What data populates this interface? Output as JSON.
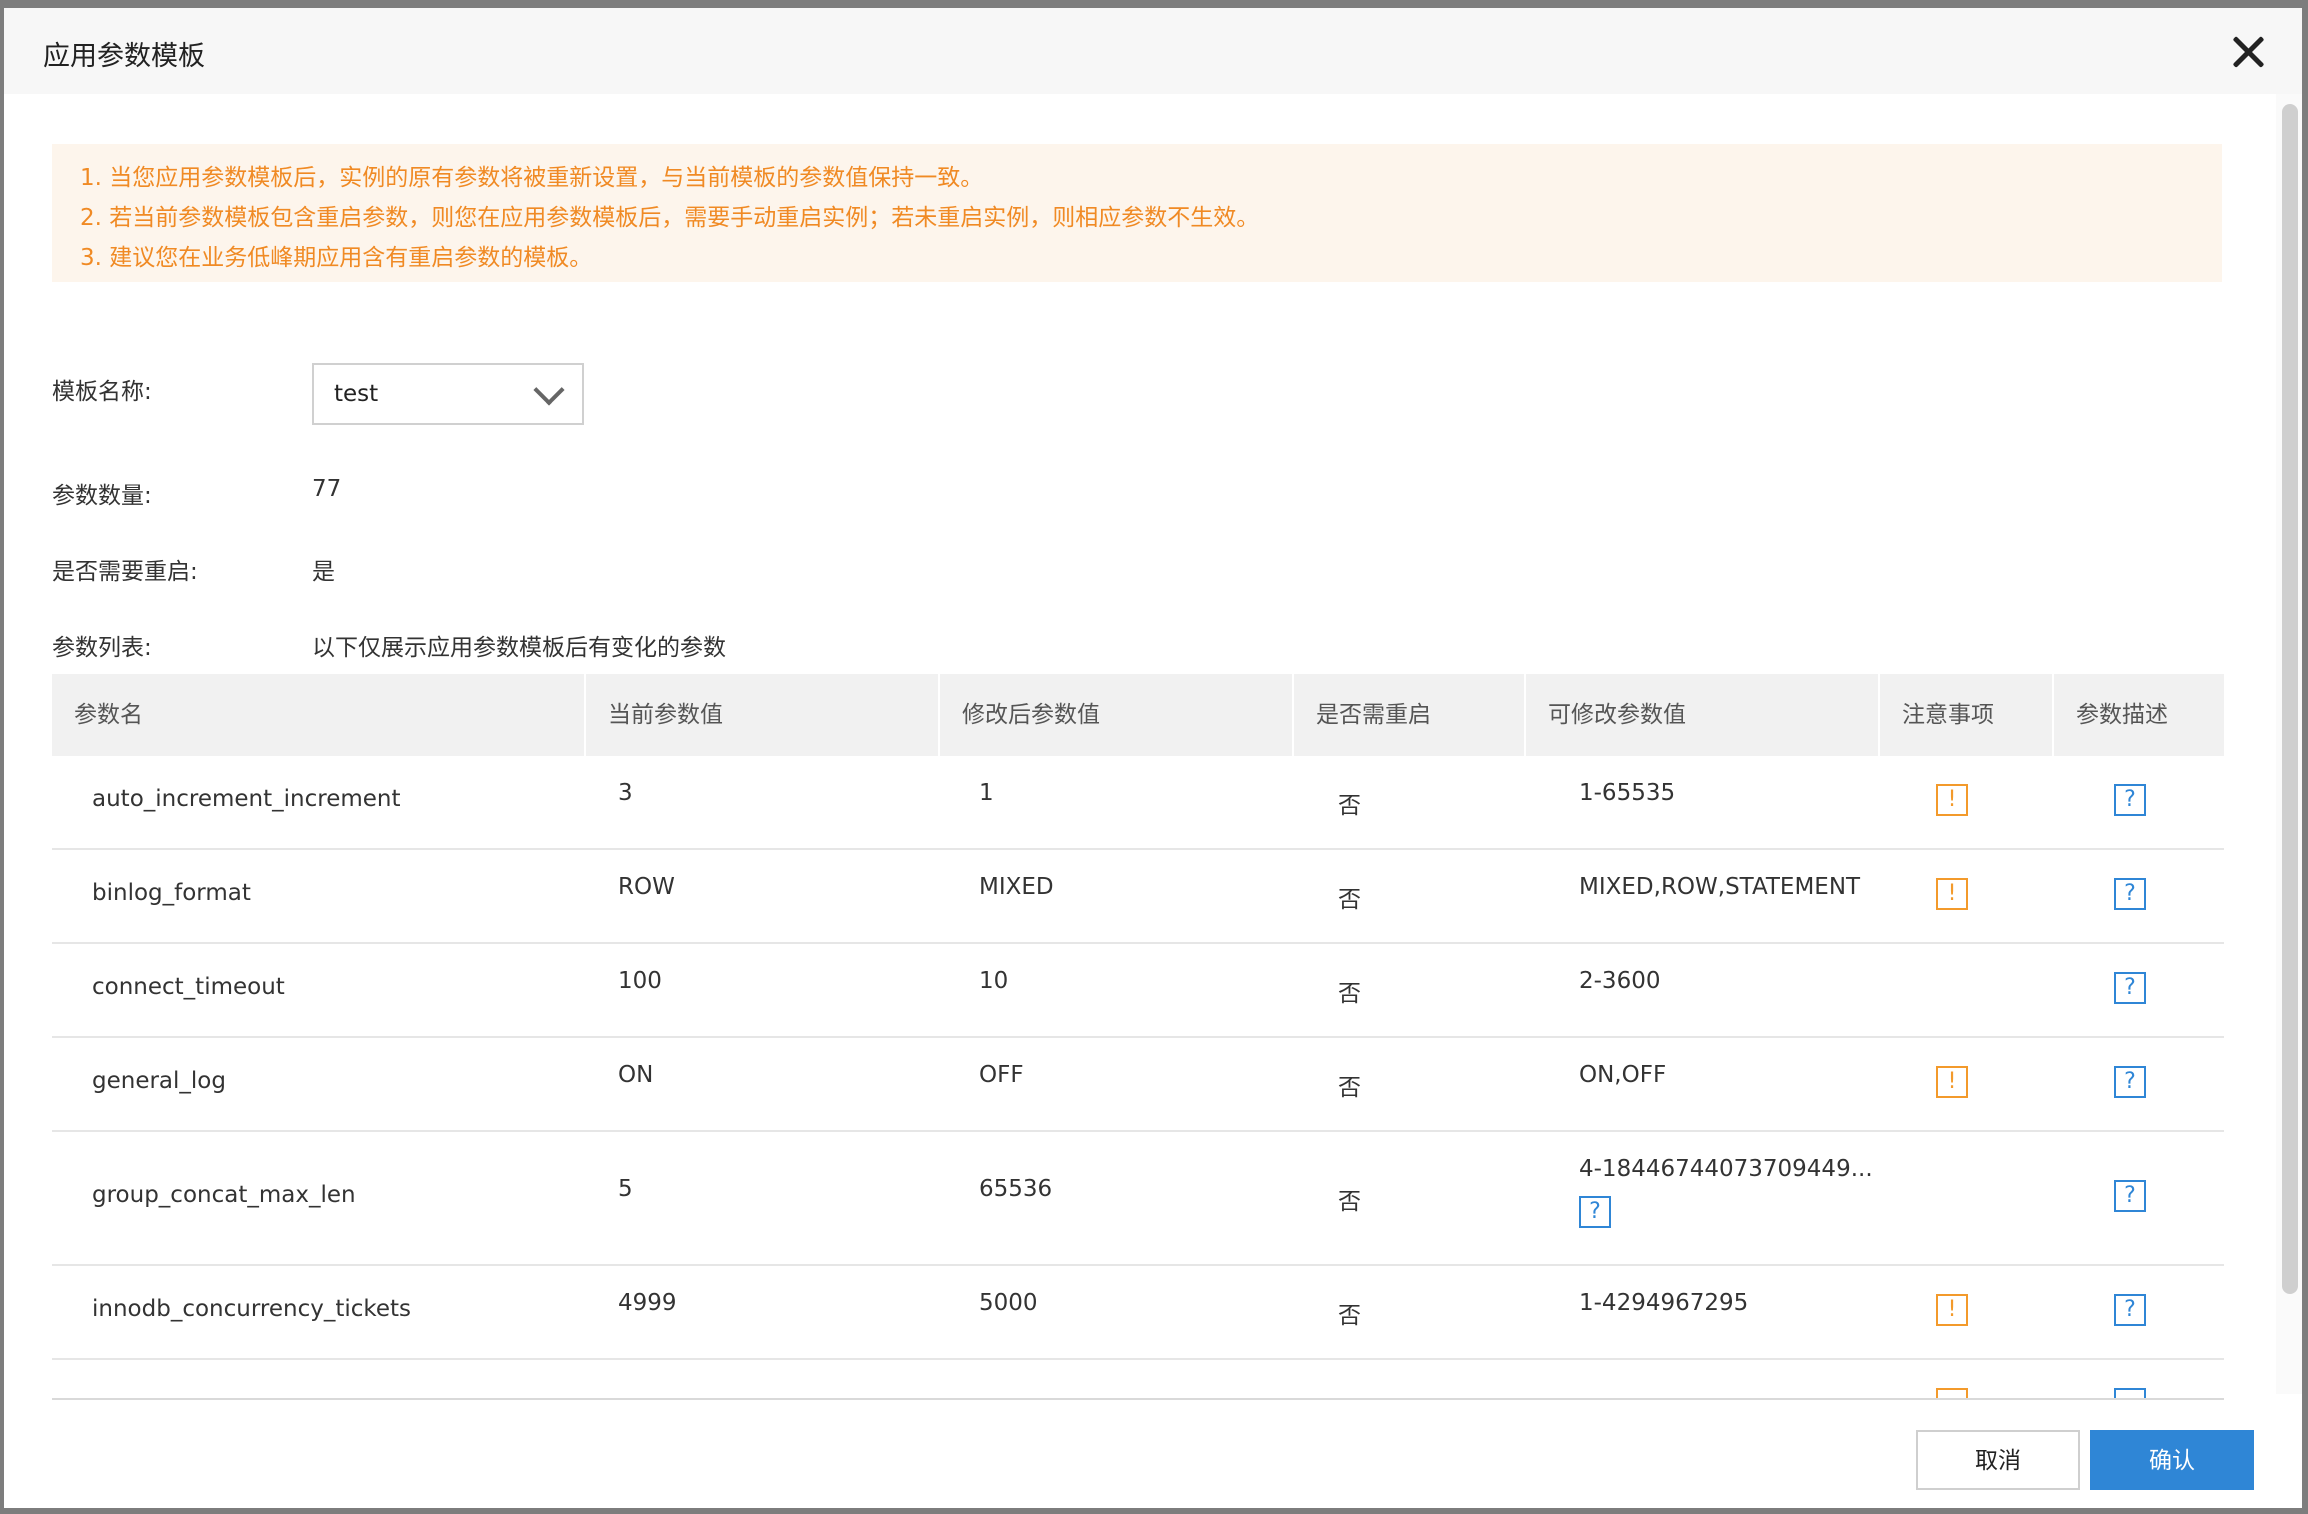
{
  "modal": {
    "title": "应用参数模板"
  },
  "notice": {
    "lines": [
      "1. 当您应用参数模板后，实例的原有参数将被重新设置，与当前模板的参数值保持一致。",
      "2. 若当前参数模板包含重启参数，则您在应用参数模板后，需要手动重启实例；若未重启实例，则相应参数不生效。",
      "3. 建议您在业务低峰期应用含有重启参数的模板。"
    ]
  },
  "form": {
    "template_label": "模板名称:",
    "template_value": "test",
    "count_label": "参数数量:",
    "count_value": "77",
    "restart_label": "是否需要重启:",
    "restart_value": "是",
    "list_label": "参数列表:",
    "list_value": "以下仅展示应用参数模板后有变化的参数"
  },
  "table": {
    "headers": [
      "参数名",
      "当前参数值",
      "修改后参数值",
      "是否需重启",
      "可修改参数值",
      "注意事项",
      "参数描述"
    ],
    "rows": [
      {
        "name": "auto_increment_increment",
        "current": "3",
        "new": "1",
        "restart": "否",
        "range": "1-65535",
        "warn": true
      },
      {
        "name": "binlog_format",
        "current": "ROW",
        "new": "MIXED",
        "restart": "否",
        "range": "MIXED,ROW,STATEMENT",
        "warn": true
      },
      {
        "name": "connect_timeout",
        "current": "100",
        "new": "10",
        "restart": "否",
        "range": "2-3600",
        "warn": false
      },
      {
        "name": "general_log",
        "current": "ON",
        "new": "OFF",
        "restart": "否",
        "range": "ON,OFF",
        "warn": true
      },
      {
        "name": "group_concat_max_len",
        "current": "5",
        "new": "65536",
        "restart": "否",
        "range": "4-18446744073709449...",
        "warn": false,
        "range_help": true
      },
      {
        "name": "innodb_concurrency_tickets",
        "current": "4999",
        "new": "5000",
        "restart": "否",
        "range": "1-4294967295",
        "warn": true
      }
    ],
    "warn_icon_char": "!",
    "help_icon_char": "?"
  },
  "buttons": {
    "cancel": "取消",
    "confirm": "确认"
  },
  "colors": {
    "accent": "#2f86d6",
    "warning": "#f39a2b",
    "notice_bg": "#fdf5ec"
  }
}
